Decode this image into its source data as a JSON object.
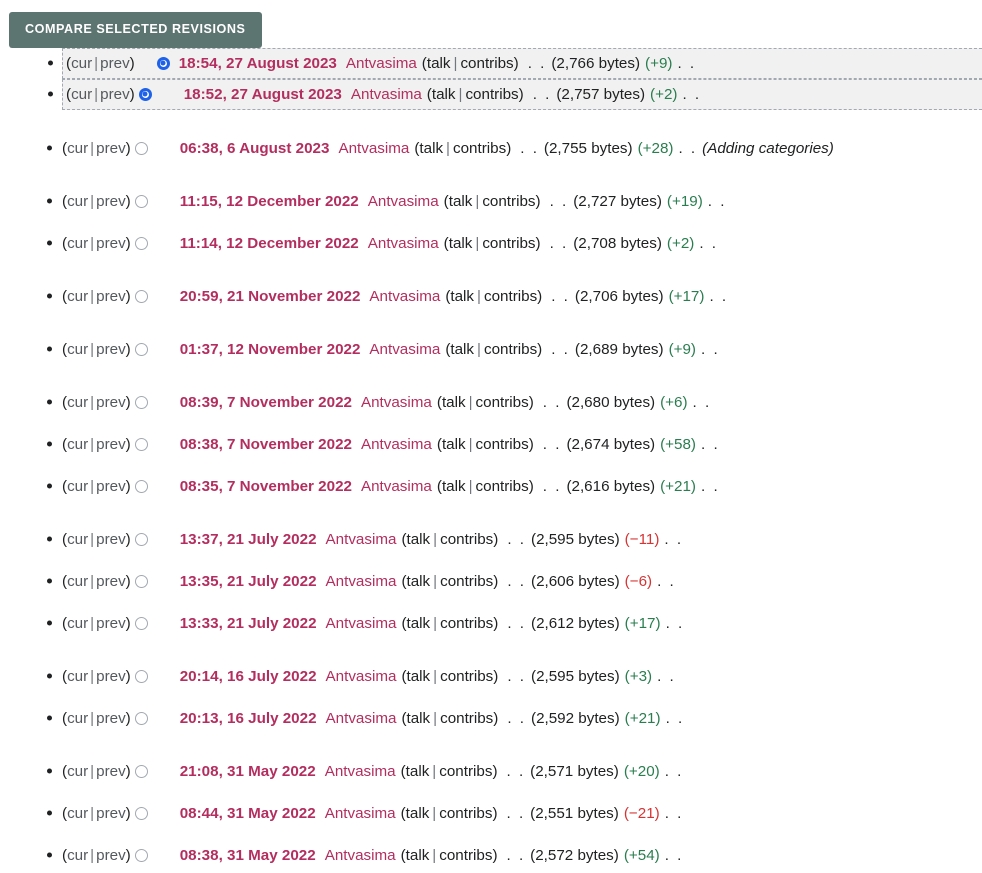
{
  "toolbar": {
    "compare_label": "Compare selected revisions"
  },
  "labels": {
    "open_paren": "(",
    "close_paren": ")",
    "pipe": "|",
    "cur": "cur",
    "prev": "prev",
    "talk": "talk",
    "contribs": "contribs",
    "dots": ". .",
    "bytes_open": "(",
    "bytes_close": " bytes)"
  },
  "colors": {
    "button_bg": "#5d7571",
    "link": "#b32e5e",
    "diff_positive": "#2a7d4f",
    "diff_negative": "#d73333",
    "row_highlight": "#f1f1f1",
    "radio_checked": "#1d62e8"
  },
  "revisions": [
    {
      "cur_is_link": false,
      "radio_state": "checked",
      "radio_side": "right",
      "selected": true,
      "group_gap": "none",
      "date": "18:54, 27 August 2023",
      "user": "Antvasima",
      "talk": "talk",
      "contribs": "contribs",
      "bytes": "(2,766 bytes)",
      "diff": "(+9)",
      "diff_sign": "pos",
      "comment": ""
    },
    {
      "cur_is_link": true,
      "radio_state": "checked",
      "radio_side": "left",
      "selected": true,
      "group_gap": "none",
      "date": "18:52, 27 August 2023",
      "user": "Antvasima",
      "talk": "talk",
      "contribs": "contribs",
      "bytes": "(2,757 bytes)",
      "diff": "(+2)",
      "diff_sign": "pos",
      "comment": ""
    },
    {
      "cur_is_link": true,
      "radio_state": "empty",
      "radio_side": "left",
      "selected": false,
      "group_gap": "large",
      "date": "06:38, 6 August 2023",
      "user": "Antvasima",
      "talk": "talk",
      "contribs": "contribs",
      "bytes": "(2,755 bytes)",
      "diff": "(+28)",
      "diff_sign": "pos",
      "comment": "(Adding categories)"
    },
    {
      "cur_is_link": true,
      "radio_state": "empty",
      "radio_side": "left",
      "selected": false,
      "group_gap": "large",
      "date": "11:15, 12 December 2022",
      "user": "Antvasima",
      "talk": "talk",
      "contribs": "contribs",
      "bytes": "(2,727 bytes)",
      "diff": "(+19)",
      "diff_sign": "pos",
      "comment": ""
    },
    {
      "cur_is_link": true,
      "radio_state": "empty",
      "radio_side": "left",
      "selected": false,
      "group_gap": "small",
      "date": "11:14, 12 December 2022",
      "user": "Antvasima",
      "talk": "talk",
      "contribs": "contribs",
      "bytes": "(2,708 bytes)",
      "diff": "(+2)",
      "diff_sign": "pos",
      "comment": ""
    },
    {
      "cur_is_link": true,
      "radio_state": "empty",
      "radio_side": "left",
      "selected": false,
      "group_gap": "large",
      "date": "20:59, 21 November 2022",
      "user": "Antvasima",
      "talk": "talk",
      "contribs": "contribs",
      "bytes": "(2,706 bytes)",
      "diff": "(+17)",
      "diff_sign": "pos",
      "comment": ""
    },
    {
      "cur_is_link": true,
      "radio_state": "empty",
      "radio_side": "left",
      "selected": false,
      "group_gap": "large",
      "date": "01:37, 12 November 2022",
      "user": "Antvasima",
      "talk": "talk",
      "contribs": "contribs",
      "bytes": "(2,689 bytes)",
      "diff": "(+9)",
      "diff_sign": "pos",
      "comment": ""
    },
    {
      "cur_is_link": true,
      "radio_state": "empty",
      "radio_side": "left",
      "selected": false,
      "group_gap": "large",
      "date": "08:39, 7 November 2022",
      "user": "Antvasima",
      "talk": "talk",
      "contribs": "contribs",
      "bytes": "(2,680 bytes)",
      "diff": "(+6)",
      "diff_sign": "pos",
      "comment": ""
    },
    {
      "cur_is_link": true,
      "radio_state": "empty",
      "radio_side": "left",
      "selected": false,
      "group_gap": "small",
      "date": "08:38, 7 November 2022",
      "user": "Antvasima",
      "talk": "talk",
      "contribs": "contribs",
      "bytes": "(2,674 bytes)",
      "diff": "(+58)",
      "diff_sign": "pos",
      "comment": ""
    },
    {
      "cur_is_link": true,
      "radio_state": "empty",
      "radio_side": "left",
      "selected": false,
      "group_gap": "small",
      "date": "08:35, 7 November 2022",
      "user": "Antvasima",
      "talk": "talk",
      "contribs": "contribs",
      "bytes": "(2,616 bytes)",
      "diff": "(+21)",
      "diff_sign": "pos",
      "comment": ""
    },
    {
      "cur_is_link": true,
      "radio_state": "empty",
      "radio_side": "left",
      "selected": false,
      "group_gap": "large",
      "date": "13:37, 21 July 2022",
      "user": "Antvasima",
      "talk": "talk",
      "contribs": "contribs",
      "bytes": "(2,595 bytes)",
      "diff": "(−11)",
      "diff_sign": "neg",
      "comment": ""
    },
    {
      "cur_is_link": true,
      "radio_state": "empty",
      "radio_side": "left",
      "selected": false,
      "group_gap": "small",
      "date": "13:35, 21 July 2022",
      "user": "Antvasima",
      "talk": "talk",
      "contribs": "contribs",
      "bytes": "(2,606 bytes)",
      "diff": "(−6)",
      "diff_sign": "neg",
      "comment": ""
    },
    {
      "cur_is_link": true,
      "radio_state": "empty",
      "radio_side": "left",
      "selected": false,
      "group_gap": "small",
      "date": "13:33, 21 July 2022",
      "user": "Antvasima",
      "talk": "talk",
      "contribs": "contribs",
      "bytes": "(2,612 bytes)",
      "diff": "(+17)",
      "diff_sign": "pos",
      "comment": ""
    },
    {
      "cur_is_link": true,
      "radio_state": "empty",
      "radio_side": "left",
      "selected": false,
      "group_gap": "large",
      "date": "20:14, 16 July 2022",
      "user": "Antvasima",
      "talk": "talk",
      "contribs": "contribs",
      "bytes": "(2,595 bytes)",
      "diff": "(+3)",
      "diff_sign": "pos",
      "comment": ""
    },
    {
      "cur_is_link": true,
      "radio_state": "empty",
      "radio_side": "left",
      "selected": false,
      "group_gap": "small",
      "date": "20:13, 16 July 2022",
      "user": "Antvasima",
      "talk": "talk",
      "contribs": "contribs",
      "bytes": "(2,592 bytes)",
      "diff": "(+21)",
      "diff_sign": "pos",
      "comment": ""
    },
    {
      "cur_is_link": true,
      "radio_state": "empty",
      "radio_side": "left",
      "selected": false,
      "group_gap": "large",
      "date": "21:08, 31 May 2022",
      "user": "Antvasima",
      "talk": "talk",
      "contribs": "contribs",
      "bytes": "(2,571 bytes)",
      "diff": "(+20)",
      "diff_sign": "pos",
      "comment": ""
    },
    {
      "cur_is_link": true,
      "radio_state": "empty",
      "radio_side": "left",
      "selected": false,
      "group_gap": "small",
      "date": "08:44, 31 May 2022",
      "user": "Antvasima",
      "talk": "talk",
      "contribs": "contribs",
      "bytes": "(2,551 bytes)",
      "diff": "(−21)",
      "diff_sign": "neg",
      "comment": ""
    },
    {
      "cur_is_link": true,
      "radio_state": "empty",
      "radio_side": "left",
      "selected": false,
      "group_gap": "small",
      "date": "08:38, 31 May 2022",
      "user": "Antvasima",
      "talk": "talk",
      "contribs": "contribs",
      "bytes": "(2,572 bytes)",
      "diff": "(+54)",
      "diff_sign": "pos",
      "comment": ""
    }
  ]
}
